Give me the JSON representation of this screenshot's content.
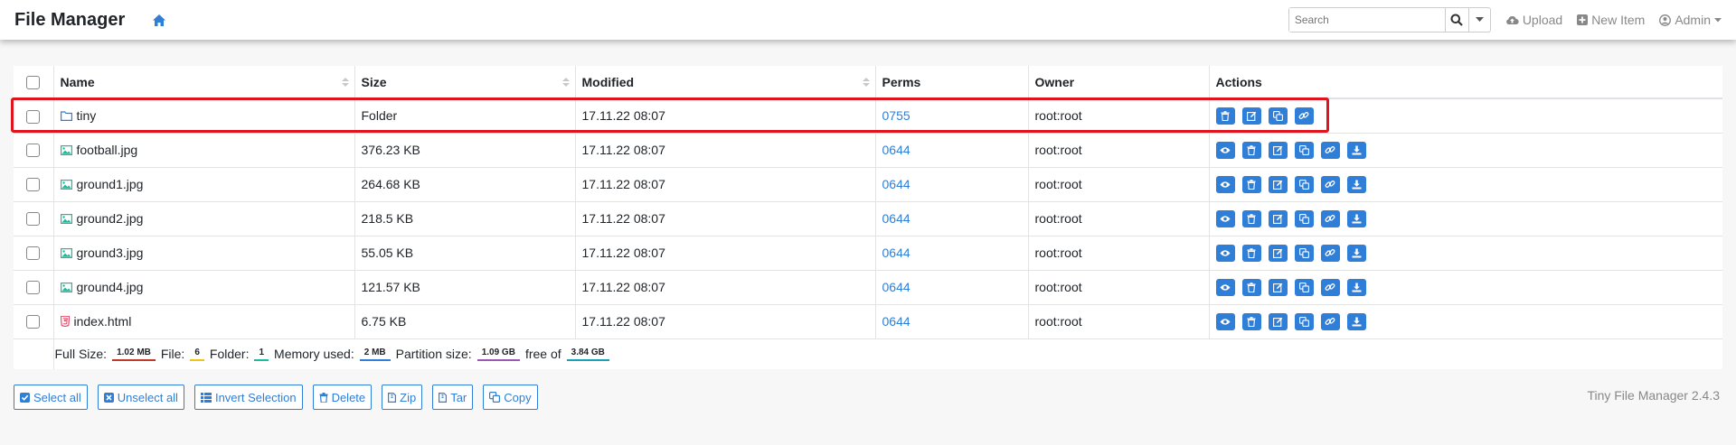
{
  "app": {
    "title": "File Manager",
    "version": "Tiny File Manager 2.4.3"
  },
  "navbar": {
    "search_placeholder": "Search",
    "upload": "Upload",
    "new_item": "New Item",
    "admin": "Admin"
  },
  "table": {
    "headers": {
      "name": "Name",
      "size": "Size",
      "modified": "Modified",
      "perms": "Perms",
      "owner": "Owner",
      "actions": "Actions"
    },
    "rows": [
      {
        "name": "tiny",
        "size": "Folder",
        "modified": "17.11.22 08:07",
        "perms": "0755",
        "owner": "root:root",
        "type": "folder"
      },
      {
        "name": "football.jpg",
        "size": "376.23 KB",
        "modified": "17.11.22 08:07",
        "perms": "0644",
        "owner": "root:root",
        "type": "image"
      },
      {
        "name": "ground1.jpg",
        "size": "264.68 KB",
        "modified": "17.11.22 08:07",
        "perms": "0644",
        "owner": "root:root",
        "type": "image"
      },
      {
        "name": "ground2.jpg",
        "size": "218.5 KB",
        "modified": "17.11.22 08:07",
        "perms": "0644",
        "owner": "root:root",
        "type": "image"
      },
      {
        "name": "ground3.jpg",
        "size": "55.05 KB",
        "modified": "17.11.22 08:07",
        "perms": "0644",
        "owner": "root:root",
        "type": "image"
      },
      {
        "name": "ground4.jpg",
        "size": "121.57 KB",
        "modified": "17.11.22 08:07",
        "perms": "0644",
        "owner": "root:root",
        "type": "image"
      },
      {
        "name": "index.html",
        "size": "6.75 KB",
        "modified": "17.11.22 08:07",
        "perms": "0644",
        "owner": "root:root",
        "type": "html"
      }
    ],
    "footer": {
      "full_size_label": "Full Size:",
      "full_size": "1.02 MB",
      "file_label": "File:",
      "file_count": "6",
      "folder_label": "Folder:",
      "folder_count": "1",
      "memory_label": "Memory used:",
      "memory": "2 MB",
      "partition_label": "Partition size:",
      "partition": "1.09 GB",
      "free_label": "free of",
      "free_total": "3.84 GB"
    }
  },
  "bottom_buttons": {
    "select_all": "Select all",
    "unselect_all": "Unselect all",
    "invert": "Invert Selection",
    "delete": "Delete",
    "zip": "Zip",
    "tar": "Tar",
    "copy": "Copy"
  },
  "colors": {
    "accent": "#2f7ed8",
    "highlight": "#e0141e",
    "badge_full_size": "#c0392b",
    "badge_file": "#f0c419",
    "badge_folder": "#1abc9c",
    "badge_memory": "#2f7ed8",
    "badge_partition": "#9b59b6",
    "badge_free": "#17a2b8"
  }
}
